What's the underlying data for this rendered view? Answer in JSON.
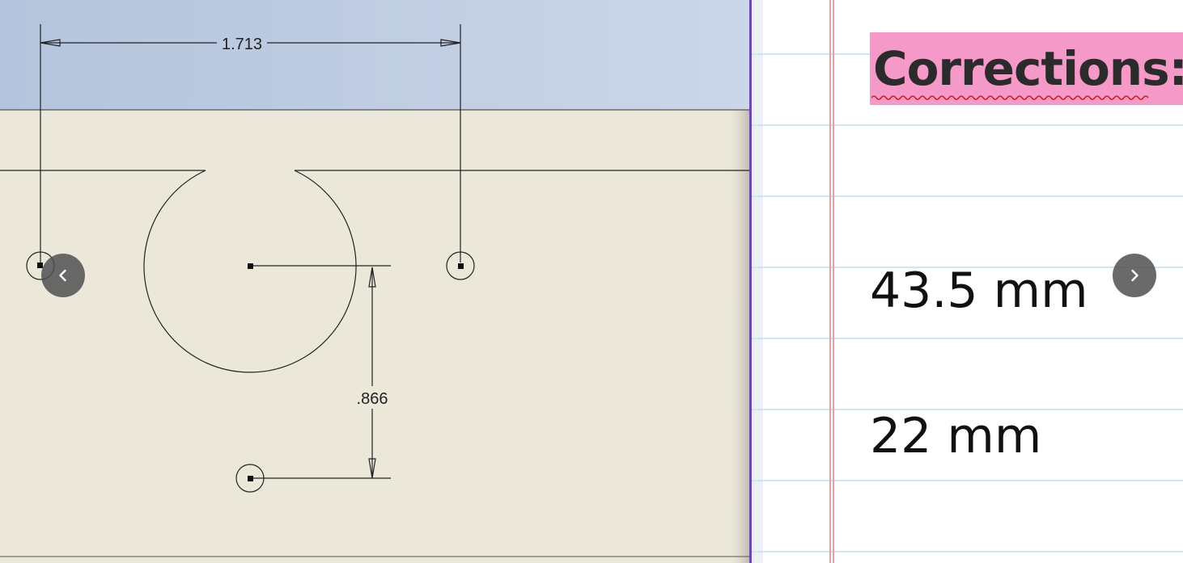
{
  "drawing": {
    "dim_horizontal": "1.713",
    "dim_vertical": ".866",
    "colors": {
      "sky_top": "#b4c4dc",
      "sky_bottom": "#cbd6e8",
      "sheet": "#ebe8da",
      "line": "#222222"
    }
  },
  "notes": {
    "title": "Corrections:",
    "value_1": "43.5 mm",
    "value_2": "22 mm",
    "highlight_color": "#f59ac8"
  },
  "nav": {
    "prev_icon": "chevron-left-icon",
    "next_icon": "chevron-right-icon"
  }
}
